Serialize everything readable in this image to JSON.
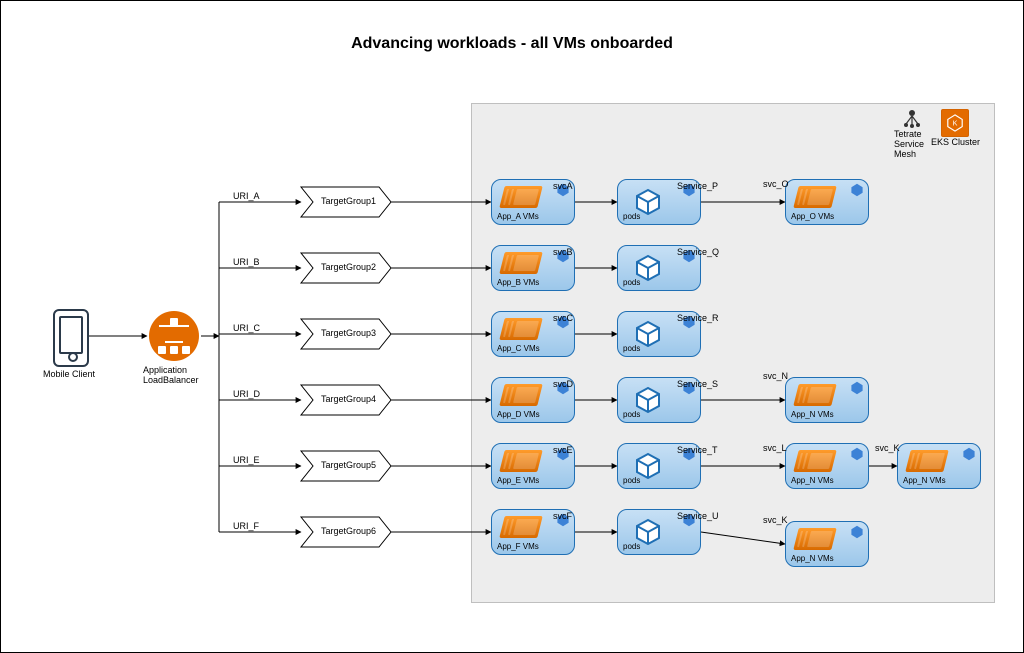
{
  "title": "Advancing workloads -  all VMs onboarded",
  "client": {
    "label": "Mobile Client"
  },
  "alb": {
    "label": "Application\nLoadBalancer"
  },
  "cluster_labels": {
    "tetrate": "Tetrate\nService\nMesh",
    "eks": "EKS Cluster"
  },
  "rows": [
    {
      "uri_label": "URI_A",
      "tg_label": "TargetGroup1",
      "app_label": "App_A VMs",
      "svc_label": "svcA",
      "pods_label": "pods",
      "service_label": "Service_P"
    },
    {
      "uri_label": "URI_B",
      "tg_label": "TargetGroup2",
      "app_label": "App_B VMs",
      "svc_label": "svcB",
      "pods_label": "pods",
      "service_label": "Service_Q"
    },
    {
      "uri_label": "URI_C",
      "tg_label": "TargetGroup3",
      "app_label": "App_C VMs",
      "svc_label": "svcC",
      "pods_label": "pods",
      "service_label": "Service_R"
    },
    {
      "uri_label": "URI_D",
      "tg_label": "TargetGroup4",
      "app_label": "App_D VMs",
      "svc_label": "svcD",
      "pods_label": "pods",
      "service_label": "Service_S"
    },
    {
      "uri_label": "URI_E",
      "tg_label": "TargetGroup5",
      "app_label": "App_E VMs",
      "svc_label": "svcE",
      "pods_label": "pods",
      "service_label": "Service_T"
    },
    {
      "uri_label": "URI_F",
      "tg_label": "TargetGroup6",
      "app_label": "App_F VMs",
      "svc_label": "svcF",
      "pods_label": "pods",
      "service_label": "Service_U"
    }
  ],
  "downstream": {
    "row0": {
      "svc_label": "svc_O",
      "app_label": "App_O VMs"
    },
    "row3": {
      "svc_label": "svc_N",
      "app_label": "App_N VMs"
    },
    "row4a": {
      "svc_label": "svc_L",
      "app_label": "App_N VMs"
    },
    "row4b": {
      "svc_label": "svc_K",
      "app_label": "App_N VMs"
    },
    "row5": {
      "svc_label": "svc_K",
      "app_label": "App_N VMs"
    }
  }
}
